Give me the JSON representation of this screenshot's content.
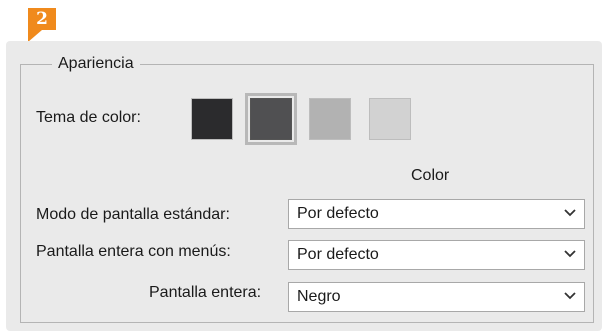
{
  "callout": {
    "number": "2"
  },
  "appearance": {
    "legend": "Apariencia",
    "theme_label": "Tema de color:",
    "swatches": [
      {
        "name": "darkest",
        "color": "#2b2b2d",
        "selected": false
      },
      {
        "name": "dark",
        "color": "#505052",
        "selected": true
      },
      {
        "name": "medium",
        "color": "#b2b2b2",
        "selected": false
      },
      {
        "name": "light",
        "color": "#d2d2d2",
        "selected": false
      }
    ],
    "column_header": "Color",
    "rows": [
      {
        "label": "Modo de pantalla estándar:",
        "value": "Por defecto"
      },
      {
        "label": "Pantalla entera con menús:",
        "value": "Por defecto"
      },
      {
        "label": "Pantalla entera:",
        "value": "Negro"
      }
    ]
  },
  "colors": {
    "accent": "#f08a1c",
    "panel": "#eaeaea"
  }
}
